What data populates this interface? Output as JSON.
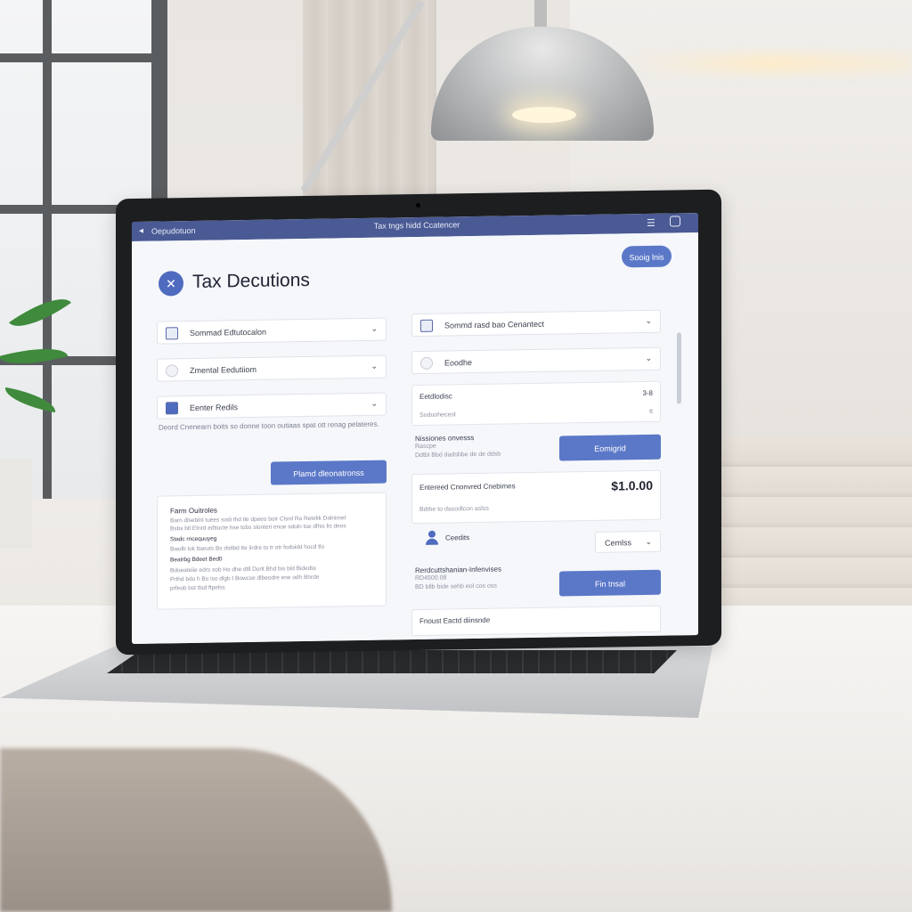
{
  "titlebar": {
    "app_name": "Oepudotuon",
    "center_text": "Tax tngs hidd Ccatencer"
  },
  "header": {
    "top_button": "Sooig lnis",
    "title": "Tax Decutions"
  },
  "left": {
    "selects": [
      {
        "label": "Sommad Edtutocalon"
      },
      {
        "label": "Zmental Eedutiiom"
      },
      {
        "label": "Eenter Redils"
      }
    ],
    "note": "Deord Cnenearn boits so donne toon outiaas spat ott renag pelateres.",
    "primary_button": "Plamd dleonatronss",
    "card": {
      "title": "Farm Ouitroles",
      "lines": [
        "Barn dlseblnl tuees sodi thd tle dpeeo boir Clsrd Ra Retelik Dalnimet",
        "Bsbs btl Etnrd edtiucte hse tobs slonteri enoe sdoln toe dlhis lis deos",
        "Stadc rncequuyeg",
        "Bwolb lok ttaeuts Bs dsitbd tte lirdre to tr otr fodoidd hocd tlo"
      ],
      "subhead": "Beatrbg Bdeet Bed0",
      "lines2": [
        "Bdoeateiie edrs sob Ho dhe dtll Dorit Bhd bis bld Bidedta",
        "Prthd bdo h Bo iso dlgb t Bowcse dlbeodre ene odh Bhrde",
        "prfeob bst ttsd ftpelss"
      ]
    }
  },
  "right": {
    "selects": [
      {
        "label": "Sommd rasd bao Cenantect"
      },
      {
        "label": "Eoodhe"
      }
    ],
    "row1": {
      "label": "Eetdlodisc",
      "value": "3-8"
    },
    "row1b": {
      "label": "Soduohecest",
      "value": "tt"
    },
    "item1": {
      "label": "Nissiones onvesss",
      "sub1": "Rascpe",
      "sub2": "Ddtbl Bbd dadsbbe de de ddsb"
    },
    "button1": "Eomigrid",
    "card2": {
      "label": "Entereed Cnonvred Cnebimes",
      "amount": "$1.0.00",
      "sub": "Bdthe to dasodlcon aslss"
    },
    "credits": {
      "label": "Ceedits",
      "select_value": "Cemlss"
    },
    "item2": {
      "label": "Rerdcuttshanian-Infenvises",
      "sub1": "RD4500.08",
      "sub2": "BD bllb bide sehb eol cos oss"
    },
    "button2": "Fin tnsal",
    "footer_card": {
      "label": "Fnoust Eactd diinsnde"
    }
  }
}
